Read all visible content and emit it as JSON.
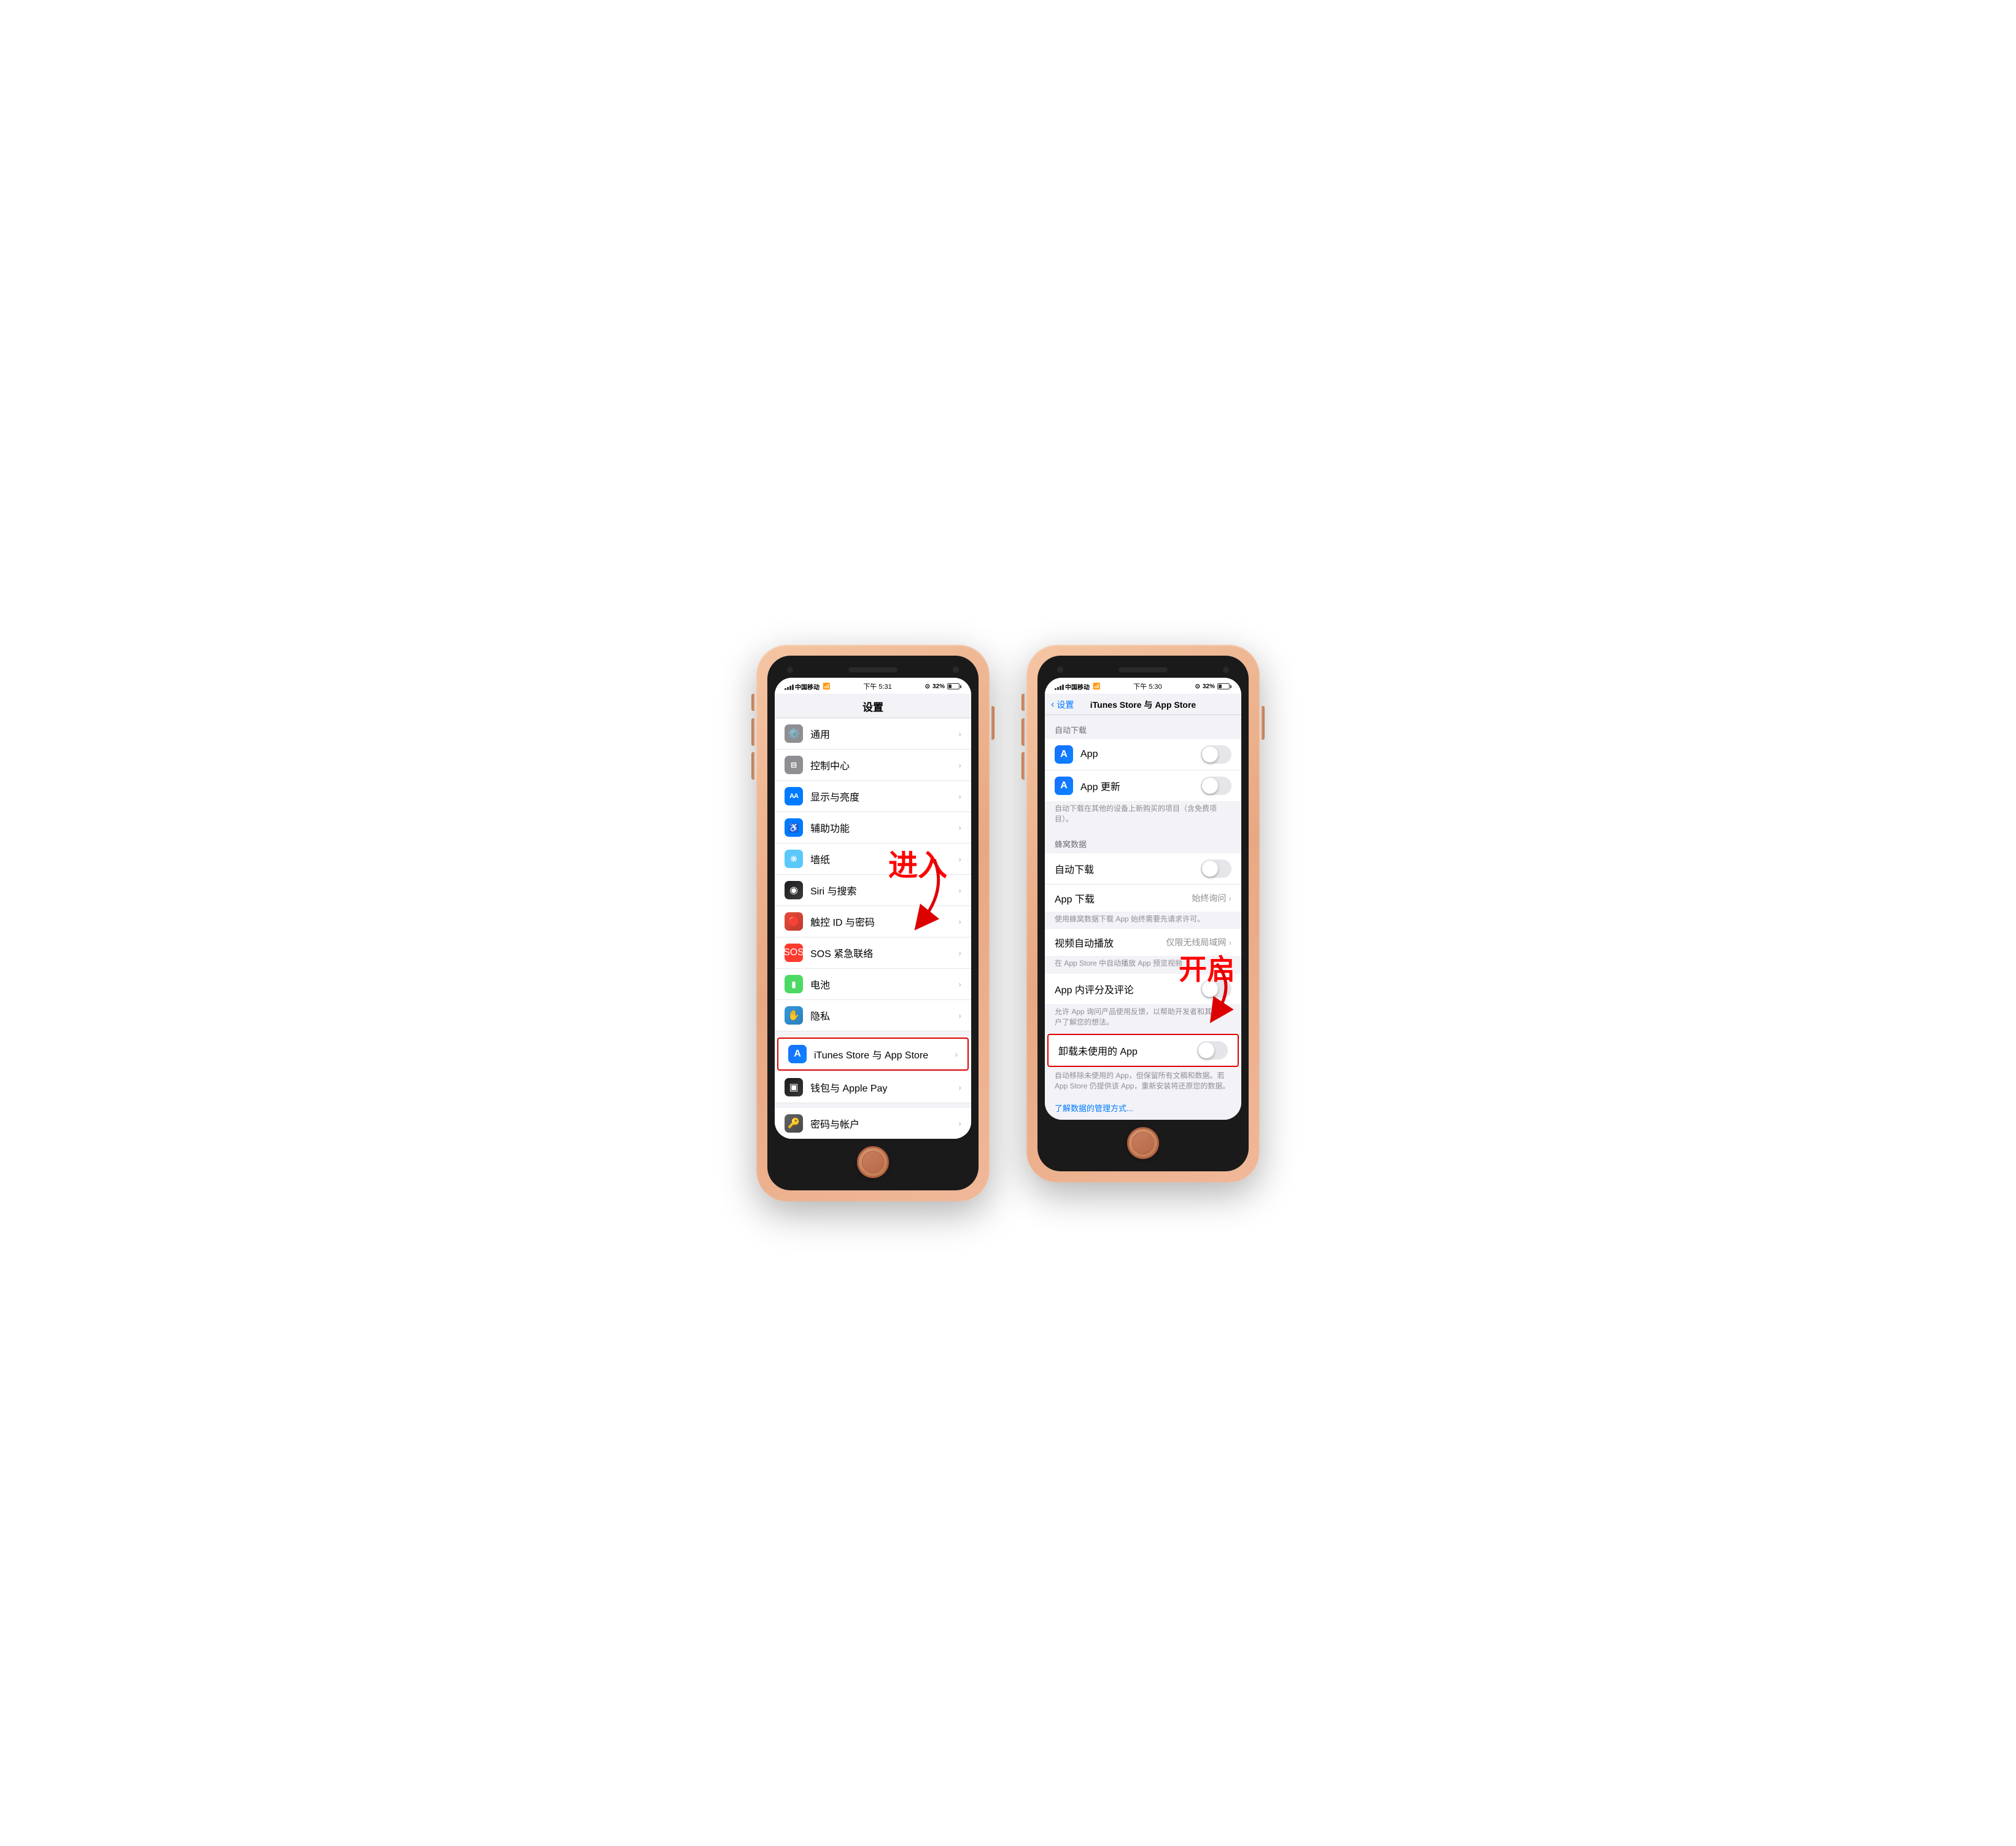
{
  "phone1": {
    "statusBar": {
      "carrier": "中国移动",
      "time": "下午 5:31",
      "battery": "32%"
    },
    "title": "设置",
    "annotation": "进入",
    "items": [
      {
        "id": "general",
        "label": "通用",
        "iconBg": "icon-gray",
        "iconChar": "⚙️"
      },
      {
        "id": "control-center",
        "label": "控制中心",
        "iconBg": "icon-gray",
        "iconChar": "⊟"
      },
      {
        "id": "display",
        "label": "显示与亮度",
        "iconBg": "icon-blue",
        "iconChar": "AA"
      },
      {
        "id": "accessibility",
        "label": "辅助功能",
        "iconBg": "icon-blue",
        "iconChar": "♿"
      },
      {
        "id": "wallpaper",
        "label": "墙纸",
        "iconBg": "icon-teal",
        "iconChar": "❋"
      },
      {
        "id": "siri",
        "label": "Siri 与搜索",
        "iconBg": "icon-dark",
        "iconChar": "◉"
      },
      {
        "id": "touchid",
        "label": "触控 ID 与密码",
        "iconBg": "icon-red",
        "iconChar": "●"
      },
      {
        "id": "sos",
        "label": "SOS 紧急联络",
        "iconBg": "icon-red",
        "iconChar": "SOS"
      },
      {
        "id": "battery",
        "label": "电池",
        "iconBg": "icon-green",
        "iconChar": "▮"
      },
      {
        "id": "privacy",
        "label": "隐私",
        "iconBg": "icon-blue",
        "iconChar": "✋"
      },
      {
        "id": "itunes",
        "label": "iTunes Store 与 App Store",
        "iconBg": "icon-app-store",
        "iconChar": "A",
        "highlighted": true
      },
      {
        "id": "wallet",
        "label": "钱包与 Apple Pay",
        "iconBg": "icon-wallet",
        "iconChar": "▣"
      },
      {
        "id": "keychain",
        "label": "密码与帐户",
        "iconBg": "icon-keychain",
        "iconChar": "🔑"
      }
    ]
  },
  "phone2": {
    "statusBar": {
      "carrier": "中国移动",
      "time": "下午 5:30",
      "battery": "32%"
    },
    "backLabel": "设置",
    "title": "iTunes Store 与 App Store",
    "annotation": "开启",
    "sections": [
      {
        "id": "auto-download",
        "header": "自动下载",
        "items": [
          {
            "id": "app",
            "label": "App",
            "iconBg": "icon-app-store",
            "iconChar": "A",
            "type": "toggle",
            "on": false
          },
          {
            "id": "app-update",
            "label": "App 更新",
            "iconBg": "icon-app-store",
            "iconChar": "A",
            "type": "toggle",
            "on": false
          }
        ],
        "footer": "自动下载在其他的设备上新购买的项目（含免费项目）。"
      },
      {
        "id": "cellular",
        "header": "蜂窝数据",
        "items": [
          {
            "id": "cellular-auto",
            "label": "自动下载",
            "type": "toggle",
            "on": false
          },
          {
            "id": "app-download",
            "label": "App 下载",
            "type": "value",
            "value": "始终询问",
            "hasChevron": true
          }
        ],
        "footer": "使用蜂窝数据下载 App 始终需要先请求许可。"
      },
      {
        "id": "video",
        "items": [
          {
            "id": "video-autoplay",
            "label": "视频自动播放",
            "type": "value",
            "value": "仅限无线局域网",
            "hasChevron": true
          }
        ],
        "footer": "在 App Store 中自动播放 App 预览视频"
      },
      {
        "id": "ratings",
        "items": [
          {
            "id": "app-ratings",
            "label": "App 内评分及评论",
            "type": "toggle",
            "on": false
          }
        ],
        "footer": "允许 App 询问产品使用反馈，以帮助开发者和其他用户了解您的想法。"
      },
      {
        "id": "offload",
        "items": [
          {
            "id": "offload-apps",
            "label": "卸载未使用的 App",
            "type": "toggle",
            "on": false,
            "highlighted": true
          }
        ],
        "footer": "自动移除未使用的 App，但保留所有文稿和数据。若 App Store 仍提供该 App，重新安装将还原您的数据。"
      }
    ],
    "link": "了解数据的管理方式..."
  }
}
